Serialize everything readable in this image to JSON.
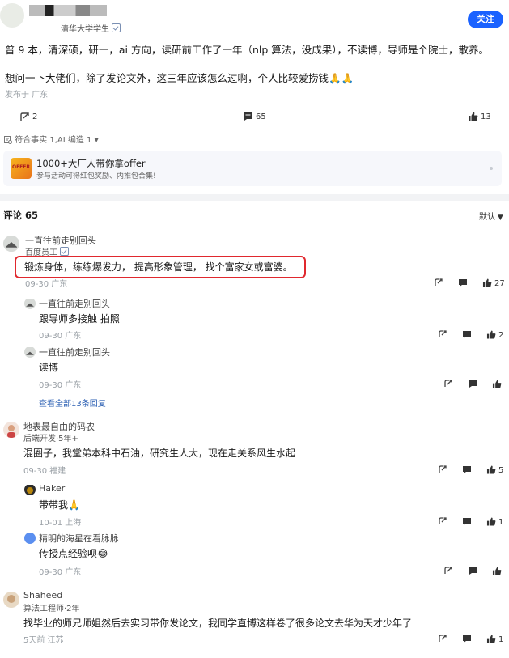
{
  "post": {
    "author_school": "清华大学学生",
    "follow_label": "关注",
    "line1": "普 9 本，清深硕，研一，ai 方向，读研前工作了一年（nlp 算法，没成果），不读博，导师是个院士，散养。",
    "line2": "想问一下大佬们，除了发论文外，这三年应该怎么过啊，个人比较爱捞钱🙏🙏",
    "location": "发布于 广东",
    "stats": {
      "shares": "2",
      "comments": "65",
      "likes": "13"
    },
    "fact_check": "符合事实 1,AI 编造 1"
  },
  "promo": {
    "icon_text": "OFFER",
    "title": "1000+大厂人带你拿offer",
    "subtitle": "参与活动可得红包奖励、内推包合集!"
  },
  "comments_header": {
    "title": "评论 65",
    "sort": "默认"
  },
  "comments": [
    {
      "name": "一直往前走别回头",
      "badge": "百度员工",
      "text": "锻炼身体，练练爆发力， 提高形象管理， 找个富家女或富婆。",
      "meta": "09-30  广东",
      "likes": "27",
      "replies": [
        {
          "name": "一直往前走别回头",
          "text": "跟导师多接触 拍照",
          "meta": "09-30  广东",
          "likes": "2"
        },
        {
          "name": "一直往前走别回头",
          "text": "读博",
          "meta": "09-30  广东",
          "likes": ""
        }
      ],
      "more_replies": "查看全部13条回复"
    },
    {
      "name": "地表最自由的码农",
      "badge": "后端开发·5年+",
      "text": "混圈子，我堂弟本科中石油，研究生人大，现在走关系风生水起",
      "meta": "09-30  福建",
      "likes": "5",
      "replies": [
        {
          "name": "Haker",
          "text": "带带我🙏",
          "meta": "10-01  上海",
          "likes": "1"
        },
        {
          "name": "精明的海星在看脉脉",
          "text": "传授点经验呗😂",
          "meta": "09-30  广东",
          "likes": ""
        }
      ]
    },
    {
      "name": "Shaheed",
      "badge": "算法工程师·2年",
      "text": "找毕业的师兄师姐然后去实习带你发论文，我同学直博这样卷了很多论文去华为天才少年了",
      "meta": "5天前  江苏",
      "likes": "1"
    }
  ],
  "colors": {
    "accent": "#1a62ff",
    "highlight": "#e0282e"
  }
}
